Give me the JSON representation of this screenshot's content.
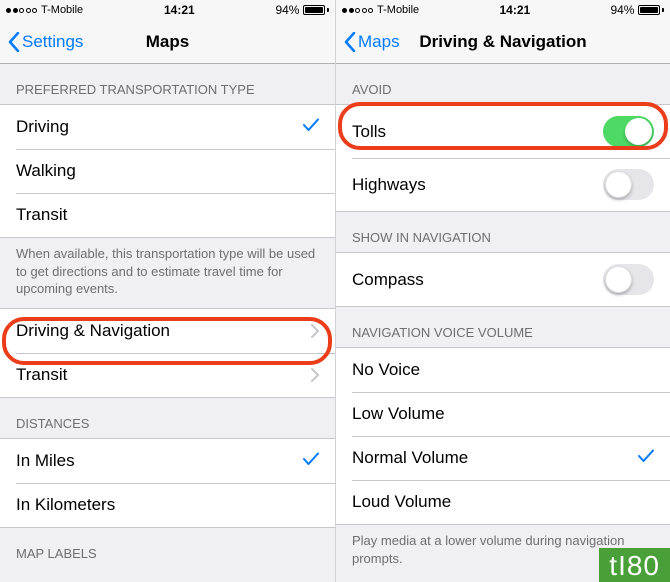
{
  "status": {
    "carrier": "T-Mobile",
    "time": "14:21",
    "battery": "94%"
  },
  "left": {
    "back": "Settings",
    "title": "Maps",
    "preferred_header": "PREFERRED TRANSPORTATION TYPE",
    "transport": {
      "driving": "Driving",
      "walking": "Walking",
      "transit": "Transit"
    },
    "preferred_footer": "When available, this transportation type will be used to get directions and to estimate travel time for upcoming events.",
    "links": {
      "driving_nav": "Driving & Navigation",
      "transit": "Transit"
    },
    "distances_header": "DISTANCES",
    "distances": {
      "miles": "In Miles",
      "km": "In Kilometers"
    },
    "map_labels_header": "MAP LABELS"
  },
  "right": {
    "back": "Maps",
    "title": "Driving & Navigation",
    "avoid_header": "AVOID",
    "avoid": {
      "tolls": "Tolls",
      "highways": "Highways"
    },
    "show_header": "SHOW IN NAVIGATION",
    "show": {
      "compass": "Compass"
    },
    "volume_header": "NAVIGATION VOICE VOLUME",
    "volume": {
      "none": "No Voice",
      "low": "Low Volume",
      "normal": "Normal Volume",
      "loud": "Loud Volume"
    },
    "volume_footer": "Play media at a lower volume during navigation prompts."
  },
  "watermark": "tI80"
}
